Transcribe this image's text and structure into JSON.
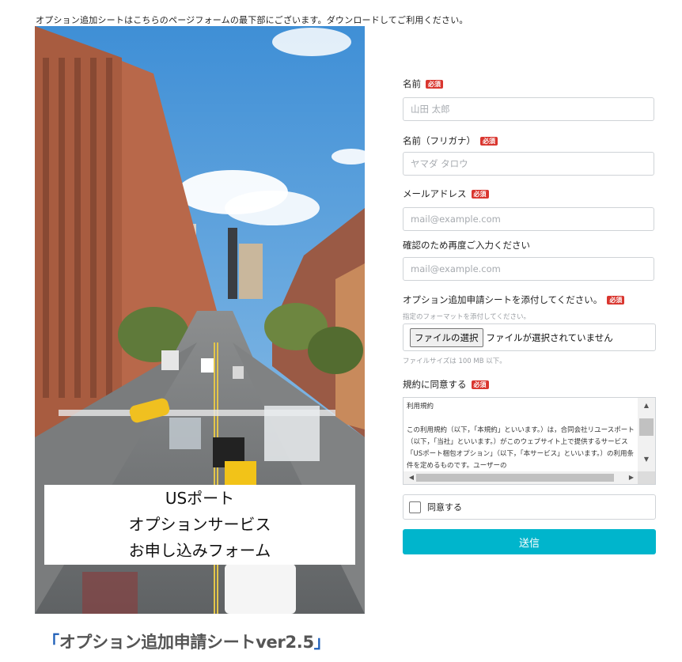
{
  "notice": "オプション追加シートはこちらのページフォームの最下部にございます。ダウンロードしてご利用ください。",
  "hero": {
    "line1": "USポート",
    "line2": "オプションサービス",
    "line3": "お申し込みフォーム"
  },
  "sheet_title": {
    "open": "「",
    "text": "オプション追加申請シートver2.5",
    "close": "」"
  },
  "form": {
    "required_badge": "必須",
    "name": {
      "label": "名前",
      "placeholder": "山田 太郎"
    },
    "furigana": {
      "label": "名前（フリガナ）",
      "placeholder": "ヤマダ タロウ"
    },
    "email": {
      "label": "メールアドレス",
      "placeholder": "mail@example.com"
    },
    "email_confirm": {
      "label": "確認のため再度ご入力ください",
      "placeholder": "mail@example.com"
    },
    "attachment": {
      "label": "オプション追加申請シートを添付してください。",
      "hint": "指定のフォーマットを添付してください。",
      "button": "ファイルの選択",
      "status": "ファイルが選択されていません",
      "size_note": "ファイルサイズは 100 MB 以下。"
    },
    "terms": {
      "label": "規約に同意する",
      "text": "利用規約\n\nこの利用規約（以下，「本規約」といいます。）は，合同会社リユースポート（以下，「当社」といいます。）がこのウェブサイト上で提供するサービス「USポート梱包オプション」（以下，「本サービス」といいます。）の利用条件を定めるものです。ユーザーの"
    },
    "agree_label": "同意する",
    "submit": "送信"
  },
  "colors": {
    "accent": "#00b5cc",
    "required": "#d9362f",
    "title_bracket": "#1f5fb8"
  }
}
